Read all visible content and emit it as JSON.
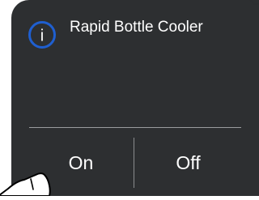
{
  "dialog": {
    "title": "Rapid Bottle Cooler",
    "info_glyph": "i",
    "icon": "info-icon",
    "accent_color": "#1f5fd0"
  },
  "buttons": {
    "on_label": "On",
    "off_label": "Off"
  },
  "pointer": {
    "icon": "hand-pointer-icon"
  }
}
